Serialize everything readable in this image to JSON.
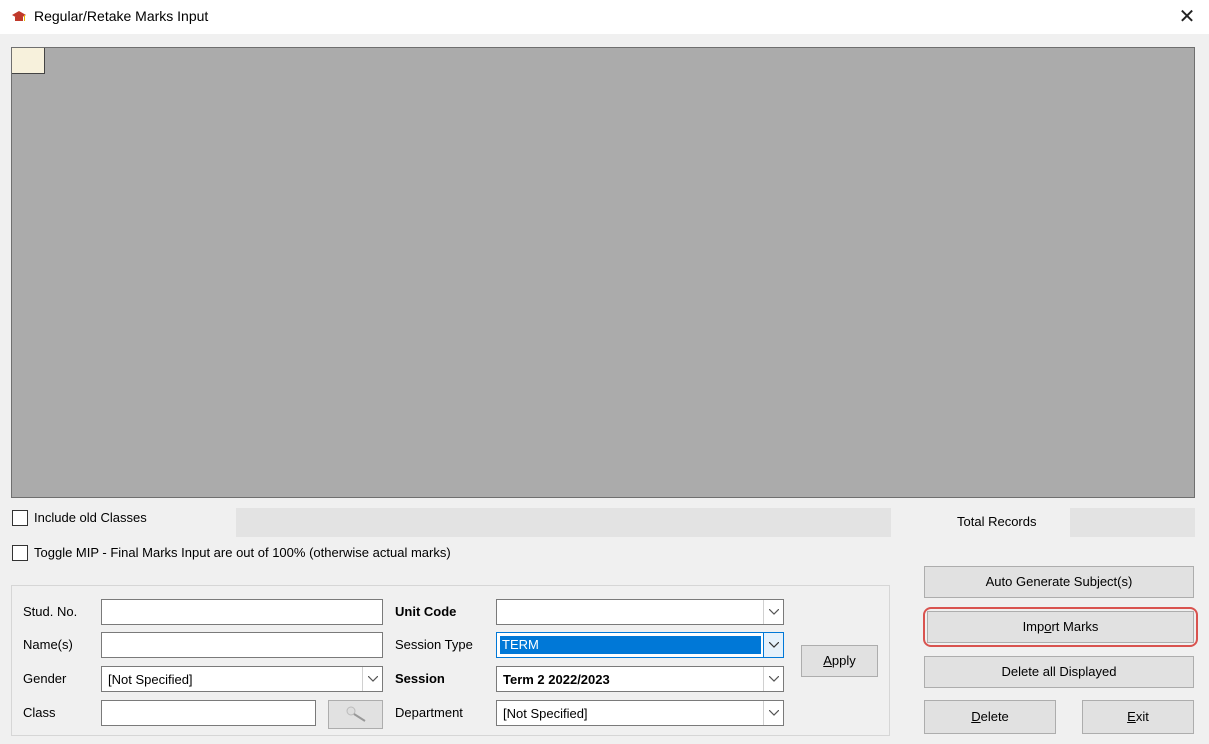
{
  "window": {
    "title": "Regular/Retake Marks Input",
    "close_glyph": "✕",
    "icon": "graduation-cap-icon"
  },
  "options": {
    "include_old_classes": "Include old Classes",
    "toggle_mip": "Toggle MIP - Final Marks Input are out of 100% (otherwise actual marks)"
  },
  "summary": {
    "total_records_label": "Total Records",
    "total_records_value": ""
  },
  "filters": {
    "stud_no_label": "Stud. No.",
    "stud_no_value": "",
    "names_label": "Name(s)",
    "names_value": "",
    "gender_label": "Gender",
    "gender_value": "[Not Specified]",
    "class_label": "Class",
    "class_value": "",
    "unit_code_label": "Unit Code",
    "unit_code_value": "",
    "session_type_label": "Session Type",
    "session_type_value": "TERM",
    "session_label": "Session",
    "session_value": "Term 2 2022/2023",
    "department_label": "Department",
    "department_value": "[Not Specified]",
    "apply_label_pre": "",
    "apply_label_mnemonic": "A",
    "apply_label_post": "pply"
  },
  "actions": {
    "auto_generate": "Auto Generate Subject(s)",
    "import_pre": "Imp",
    "import_mnemonic": "o",
    "import_post": "rt Marks",
    "delete_all_displayed": "Delete all Displayed",
    "delete_mnemonic": "D",
    "delete_post": "elete",
    "exit_mnemonic": "E",
    "exit_post": "xit"
  },
  "colors": {
    "grid_background": "#ababab",
    "selection": "#0078d7",
    "highlight_outline": "#d9534f"
  }
}
